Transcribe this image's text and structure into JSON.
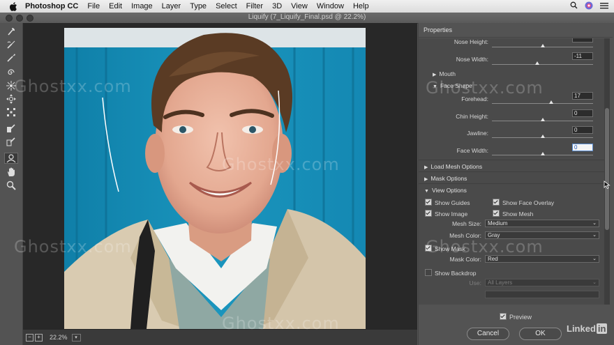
{
  "menubar": {
    "app_name": "Photoshop CC",
    "items": [
      "File",
      "Edit",
      "Image",
      "Layer",
      "Type",
      "Select",
      "Filter",
      "3D",
      "View",
      "Window",
      "Help"
    ]
  },
  "dialog": {
    "title": "Liquify (7_Liquify_Final.psd @ 22.2%)"
  },
  "canvas": {
    "zoom": "22.2%"
  },
  "panel": {
    "header": "Properties",
    "nose": {
      "height_label": "Nose Height:",
      "width_label": "Nose Width:",
      "width_value": "-11"
    },
    "mouth_label": "Mouth",
    "face_shape": {
      "label": "Face Shape",
      "forehead_label": "Forehead:",
      "forehead_value": "17",
      "chin_label": "Chin Height:",
      "chin_value": "0",
      "jawline_label": "Jawline:",
      "jawline_value": "0",
      "face_width_label": "Face Width:",
      "face_width_value": "0"
    },
    "load_mesh_label": "Load Mesh Options",
    "mask_options_label": "Mask Options",
    "view_options": {
      "label": "View Options",
      "show_guides": "Show Guides",
      "show_face_overlay": "Show Face Overlay",
      "show_image": "Show Image",
      "show_mesh": "Show Mesh",
      "mesh_size_label": "Mesh Size:",
      "mesh_size_value": "Medium",
      "mesh_color_label": "Mesh Color:",
      "mesh_color_value": "Gray",
      "show_mask": "Show Mask",
      "mask_color_label": "Mask Color:",
      "mask_color_value": "Red",
      "show_backdrop": "Show Backdrop",
      "use_label": "Use:",
      "use_value": "All Layers"
    }
  },
  "footer": {
    "preview_label": "Preview",
    "cancel_label": "Cancel",
    "ok_label": "OK"
  },
  "watermark": "Ghostxx.com",
  "brand": {
    "text": "Linked",
    "in": "in"
  },
  "colors": {
    "panel_bg": "#535353",
    "backdrop_blue": "#1a8cb0",
    "focus_blue": "#5b8fd4"
  }
}
